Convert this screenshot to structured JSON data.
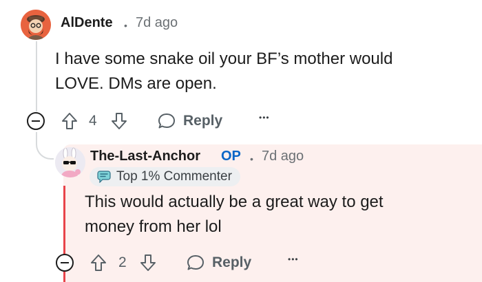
{
  "comment": {
    "username": "AlDente",
    "time": "7d ago",
    "body_line1": "I have some snake oil your BF’s mother would",
    "body_line2": "LOVE. DMs are open.",
    "upvotes": "4",
    "reply_label": "Reply"
  },
  "reply": {
    "username": "The-Last-Anchor",
    "op_label": "OP",
    "time": "7d ago",
    "badge_label": "Top 1% Commenter",
    "body_line1": "This would actually be a great way to get",
    "body_line2": "money from her lol",
    "upvotes": "2",
    "reply_label": "Reply"
  },
  "separator": "•",
  "more_label": "•••",
  "colors": {
    "op_blue": "#0a66c7",
    "highlight_bg": "#fdf0ee",
    "thread_line": "#d7dadc",
    "reply_marker": "#e8444a"
  }
}
